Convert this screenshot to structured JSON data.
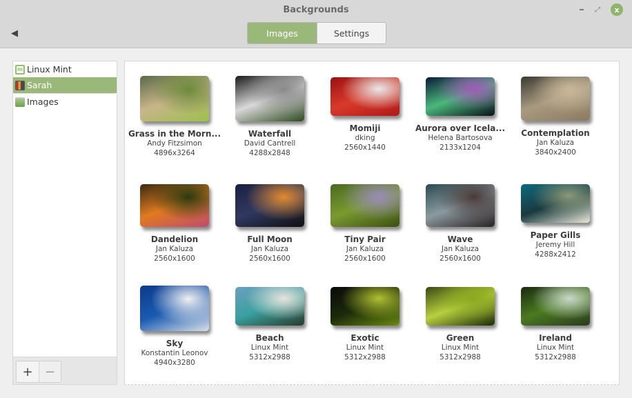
{
  "window": {
    "title": "Backgrounds",
    "controls": {
      "minimize": "–",
      "maximize": "⤢",
      "close": "x"
    }
  },
  "header": {
    "back_icon": "◀",
    "tabs": [
      {
        "label": "Images",
        "active": true
      },
      {
        "label": "Settings",
        "active": false
      }
    ],
    "accent_color": "#9ab87a"
  },
  "sidebar": {
    "items": [
      {
        "label": "Linux Mint",
        "icon": "linux-mint-icon",
        "selected": false
      },
      {
        "label": "Sarah",
        "icon": "sarah-icon",
        "selected": true
      },
      {
        "label": "Images",
        "icon": "folder-icon",
        "selected": false
      }
    ],
    "add_label": "+",
    "remove_label": "−"
  },
  "wallpapers": [
    {
      "title": "Grass in the Morn...",
      "author": "Andy Fitzsimon",
      "size": "4896x3264",
      "colors": [
        "#5a6a4a",
        "#c9b48a",
        "#6b8a3a",
        "#9cc04a"
      ]
    },
    {
      "title": "Waterfall",
      "author": "David Cantrell",
      "size": "4288x2848",
      "colors": [
        "#1a1a1a",
        "#d9d9d9",
        "#8a8a8a",
        "#2e4a20"
      ]
    },
    {
      "title": "Momiji",
      "author": "dking",
      "size": "2560x1440",
      "colors": [
        "#9a1010",
        "#d83a2a",
        "#e8e8e8",
        "#b01818"
      ]
    },
    {
      "title": "Aurora over Icela...",
      "author": "Helena Bartosova",
      "size": "2133x1204",
      "colors": [
        "#0a1a3a",
        "#4ab87a",
        "#a05ab8",
        "#0a0f1a"
      ]
    },
    {
      "title": "Contemplation",
      "author": "Jan Kaluza",
      "size": "3840x2400",
      "colors": [
        "#3a3a30",
        "#a89a80",
        "#c8b898",
        "#8a7a60"
      ]
    },
    {
      "title": "Dandelion",
      "author": "Jan Kaluza",
      "size": "2560x1600",
      "colors": [
        "#3a2a10",
        "#e07a20",
        "#2a3a10",
        "#c04a70"
      ]
    },
    {
      "title": "Full Moon",
      "author": "Jan Kaluza",
      "size": "2560x1600",
      "colors": [
        "#1a2040",
        "#303860",
        "#e08a30",
        "#101010"
      ]
    },
    {
      "title": "Tiny Pair",
      "author": "Jan Kaluza",
      "size": "2560x1600",
      "colors": [
        "#4a6a20",
        "#7a9a30",
        "#9a8ab8",
        "#3a5010"
      ]
    },
    {
      "title": "Wave",
      "author": "Jan Kaluza",
      "size": "2560x1600",
      "colors": [
        "#2a4a50",
        "#8a9aa0",
        "#4a3a38",
        "#2a2020"
      ]
    },
    {
      "title": "Paper Gills",
      "author": "Jeremy Hill",
      "size": "4288x2412",
      "colors": [
        "#0a6a80",
        "#1a3a40",
        "#8a9a7a",
        "#e8e8d8"
      ]
    },
    {
      "title": "Sky",
      "author": "Konstantin Leonov",
      "size": "4940x3280",
      "colors": [
        "#0a3a8a",
        "#1a5ab0",
        "#f0f0f0",
        "#d8e0e8"
      ]
    },
    {
      "title": "Beach",
      "author": "Linux Mint",
      "size": "5312x2988",
      "colors": [
        "#6aa0c0",
        "#3aa0a0",
        "#e8e4dc",
        "#2a3a2a"
      ]
    },
    {
      "title": "Exotic",
      "author": "Linux Mint",
      "size": "5312x2988",
      "colors": [
        "#0a0a0a",
        "#1a2a0a",
        "#b0c030",
        "#6a8a10"
      ]
    },
    {
      "title": "Green",
      "author": "Linux Mint",
      "size": "5312x2988",
      "colors": [
        "#3a4a10",
        "#b8d040",
        "#8aa820",
        "#1a2a08"
      ]
    },
    {
      "title": "Ireland",
      "author": "Linux Mint",
      "size": "5312x2988",
      "colors": [
        "#1a2a10",
        "#4a7a20",
        "#c8d8c8",
        "#2a3a20"
      ]
    }
  ]
}
